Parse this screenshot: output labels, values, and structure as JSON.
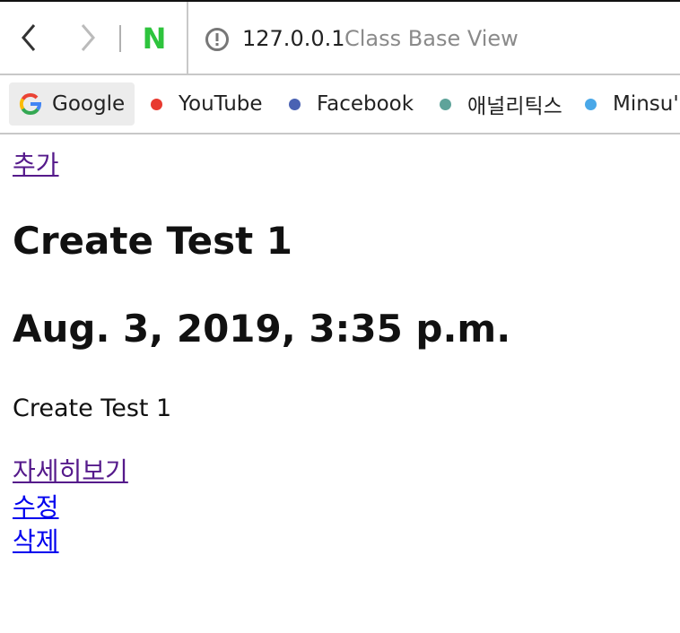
{
  "browser": {
    "url_host": "127.0.0.1",
    "page_title": "Class Base View",
    "naver_logo": "N",
    "bookmarks": [
      {
        "label": "Google",
        "icon": "google-icon"
      },
      {
        "label": "YouTube",
        "dot_color": "#e8392f"
      },
      {
        "label": "Facebook",
        "dot_color": "#4a62b3"
      },
      {
        "label": "애널리틱스",
        "dot_color": "#5ea39a"
      },
      {
        "label": "Minsu'",
        "dot_color": "#4aa8e8"
      }
    ]
  },
  "page": {
    "add_link": "추가",
    "title": "Create Test 1",
    "date": "Aug. 3, 2019, 3:35 p.m.",
    "body": "Create Test 1",
    "detail_link": "자세히보기",
    "edit_link": "수정",
    "delete_link": "삭제"
  }
}
